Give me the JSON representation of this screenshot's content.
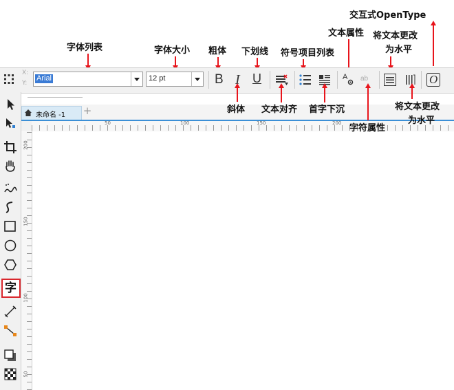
{
  "annotations": {
    "font_list": "字体列表",
    "font_size": "字体大小",
    "bold": "粗体",
    "underline": "下划线",
    "bullet_list": "符号项目列表",
    "text_properties": "文本属性",
    "interactive_opentype": "交互式OpenType",
    "change_to_horizontal_top_line1": "将文本更改",
    "change_to_horizontal_top_line2": "为水平",
    "italic": "斜体",
    "text_align": "文本对齐",
    "drop_cap": "首字下沉",
    "char_properties": "字符属性",
    "change_to_horizontal_bottom_line1": "将文本更改",
    "change_to_horizontal_bottom_line2": "为水平"
  },
  "toolbar": {
    "x_label": "X:",
    "y_label": "Y:",
    "font_value": "Arial",
    "size_value": "12 pt",
    "bold_glyph": "B",
    "italic_glyph": "I",
    "underline_glyph": "U",
    "opentype_glyph": "O",
    "text_props_glyph": "A",
    "char_props_glyph": "ab"
  },
  "tab": {
    "label": "未命名 -1",
    "add": "+"
  },
  "rulers": {
    "horizontal": [
      "50",
      "100",
      "150",
      "200"
    ],
    "vertical": [
      "200",
      "150",
      "100",
      "50"
    ]
  },
  "left_tools": {
    "text_tool_glyph": "字"
  },
  "colors": {
    "arrow": "#e8141b",
    "highlight": "#d9262c",
    "selection": "#3b8fd6"
  }
}
